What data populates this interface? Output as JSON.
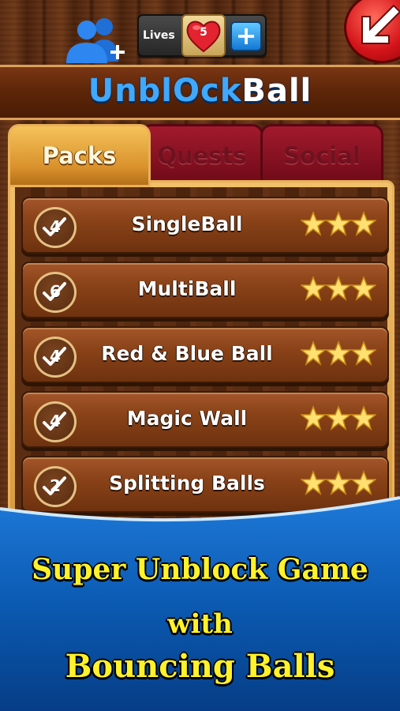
{
  "header": {
    "lives_label": "Lives",
    "lives_count": "5",
    "logo_part1": "Unbl",
    "logo_part2": "O",
    "logo_part3": "ck",
    "logo_part4": "Ball"
  },
  "tabs": [
    {
      "label": "Packs",
      "active": true
    },
    {
      "label": "Quests",
      "active": false
    },
    {
      "label": "Social",
      "active": false
    }
  ],
  "packs": [
    {
      "name": "SingleBall",
      "count": "4",
      "stars": 3
    },
    {
      "name": "MultiBall",
      "count": "6",
      "stars": 3
    },
    {
      "name": "Red & Blue Ball",
      "count": "4",
      "stars": 3
    },
    {
      "name": "Magic Wall",
      "count": "4",
      "stars": 3
    },
    {
      "name": "Splitting Balls",
      "count": "2",
      "stars": 3
    }
  ],
  "promo": {
    "line1": "Super Unblock Game",
    "line2": "with",
    "line3": "Bouncing Balls"
  },
  "colors": {
    "logo_blue": "#3ea9ff",
    "promo_text": "#fff22a",
    "promo_bg": "#0b5ab2",
    "tab_active": "#e0a040",
    "tab_inactive": "#8a1022"
  },
  "icons": {
    "friends": "add-friend-icon",
    "heart": "heart-icon",
    "plus": "plus-icon",
    "back": "back-arrow-icon",
    "check": "checkmark-icon",
    "star": "star-icon"
  }
}
